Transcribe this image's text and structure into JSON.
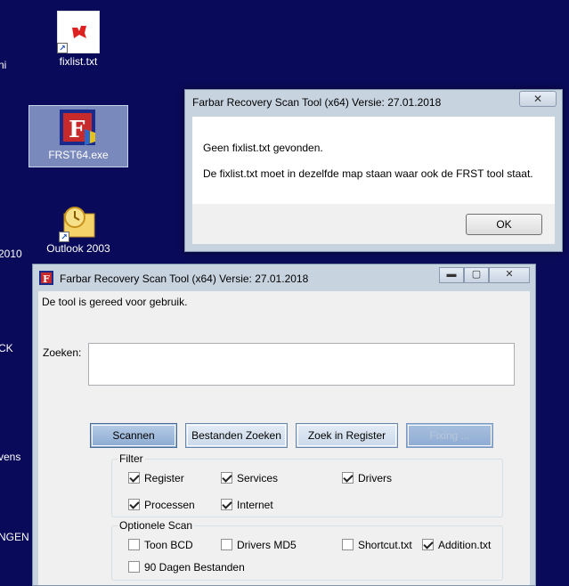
{
  "desktop": {
    "edge_labels": [
      "ni",
      "2010",
      "CK",
      "vens",
      "NGEN"
    ],
    "icons": [
      {
        "name": "fixlist.txt"
      },
      {
        "name": "FRST64.exe"
      },
      {
        "name": "Outlook 2003"
      }
    ]
  },
  "msgbox": {
    "title": "Farbar Recovery Scan Tool (x64) Versie: 27.01.2018",
    "close_glyph": "✕",
    "line1": "Geen fixlist.txt gevonden.",
    "line2": "De fixlist.txt moet in dezelfde map staan waar ook de FRST tool staat.",
    "ok_label": "OK"
  },
  "main": {
    "title": "Farbar Recovery Scan Tool (x64) Versie: 27.01.2018",
    "minimize_glyph": "▬",
    "maximize_glyph": "▢",
    "close_glyph": "✕",
    "status": "De tool is gereed voor gebruik.",
    "search_label": "Zoeken:",
    "search_value": "",
    "buttons": {
      "scan": "Scannen",
      "search_files": "Bestanden Zoeken",
      "search_registry": "Zoek in Register",
      "fix": "Fixing ..."
    },
    "filter": {
      "label": "Filter",
      "items": [
        {
          "label": "Register",
          "checked": true
        },
        {
          "label": "Services",
          "checked": true
        },
        {
          "label": "Drivers",
          "checked": true
        },
        {
          "label": "Processen",
          "checked": true
        },
        {
          "label": "Internet",
          "checked": true
        }
      ]
    },
    "optional": {
      "label": "Optionele Scan",
      "items": [
        {
          "label": "Toon BCD",
          "checked": false
        },
        {
          "label": "Drivers MD5",
          "checked": false
        },
        {
          "label": "Shortcut.txt",
          "checked": false
        },
        {
          "label": "Addition.txt",
          "checked": true
        },
        {
          "label": "90 Dagen Bestanden",
          "checked": false
        }
      ]
    }
  },
  "colors": {
    "desktop": "#0a0a5a",
    "window_frame": "#c8d3e0",
    "button_primary": "#8aaad2"
  }
}
